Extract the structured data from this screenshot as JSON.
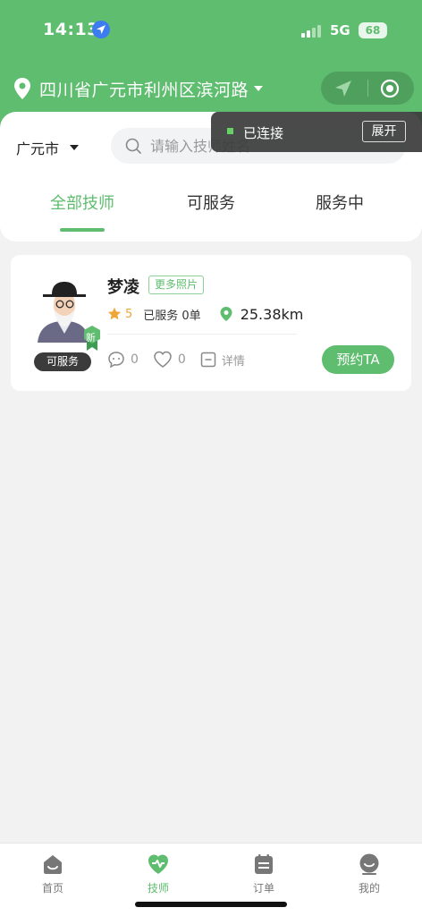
{
  "status_bar": {
    "time": "14:13",
    "network": "5G",
    "battery": "68"
  },
  "header": {
    "address": "四川省广元市利州区滨河路"
  },
  "toast": {
    "text": "已连接",
    "expand_label": "展开"
  },
  "filter": {
    "city": "广元市",
    "search_placeholder": "请输入技师姓名"
  },
  "tabs": [
    {
      "label": "全部技师",
      "active": true
    },
    {
      "label": "可服务",
      "active": false
    },
    {
      "label": "服务中",
      "active": false
    }
  ],
  "technicians": [
    {
      "name": "梦凌",
      "more_photos_label": "更多照片",
      "badge_new": "新",
      "rating": "5",
      "served": "已服务 0单",
      "distance": "25.38km",
      "comments": "0",
      "likes": "0",
      "detail_label": "详情",
      "status": "可服务",
      "book_label": "预约TA"
    }
  ],
  "bottom_nav": [
    {
      "label": "首页",
      "icon": "home-icon",
      "active": false
    },
    {
      "label": "技师",
      "icon": "technician-icon",
      "active": true
    },
    {
      "label": "订单",
      "icon": "order-icon",
      "active": false
    },
    {
      "label": "我的",
      "icon": "profile-icon",
      "active": false
    }
  ],
  "colors": {
    "brand_green": "#5ebd6e",
    "rating_orange": "#f0a637",
    "toast_bg": "#3c3c3c"
  }
}
